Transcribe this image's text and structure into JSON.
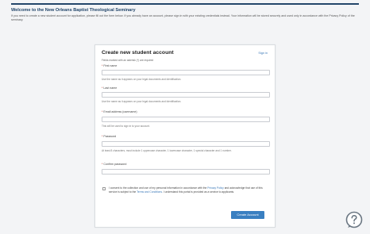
{
  "header": {
    "title": "Welcome to the New Orleans Baptist Theological Seminary",
    "intro": "If you need to create a new student account for application, please fill out the form below. If you already have an account, please sign in with your existing credentials instead. Your information will be stored securely and used only in accordance with the Privacy Policy of the seminary."
  },
  "form": {
    "title": "Create new student account",
    "signin_label": "Sign in",
    "required_note": "Fields marked with an asterisk (*) are required",
    "fields": [
      {
        "label": "First name",
        "help": "Use the name as it appears on your legal documents and identification."
      },
      {
        "label": "Last name",
        "help": "Use the name as it appears on your legal documents and identification."
      },
      {
        "label": "Email address (username)",
        "help": "This will be used to sign in to your account."
      },
      {
        "label": "Password",
        "help": "At least 8 characters, must include 1 uppercase character, 1 lowercase character, 1 special character and 1 number."
      },
      {
        "label": "Confirm password",
        "help": ""
      }
    ],
    "consent": {
      "text_before": "I consent to the collection and use of my personal information in accordance with the ",
      "privacy_link": "Privacy Policy",
      "text_middle": " and acknowledge that use of this service is subject to the ",
      "terms_link": "Terms and Conditions",
      "text_after": ". I understand this portal is provided as a service to applicants."
    },
    "submit_label": "Create Account"
  },
  "colors": {
    "primary": "#3a7fc1",
    "heading": "#23466a",
    "link": "#3a78b8",
    "required": "#c0392b"
  },
  "icons": {
    "help": "help-chat-icon"
  }
}
